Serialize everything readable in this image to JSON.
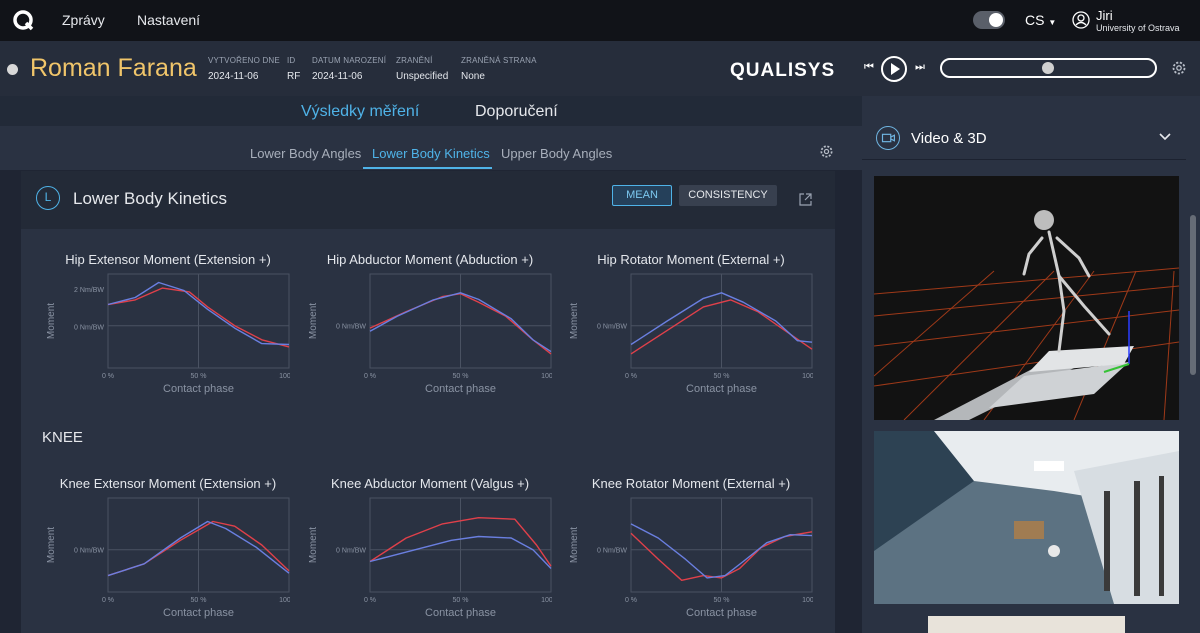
{
  "nav": {
    "messages": "Zprávy",
    "settings": "Nastavení",
    "lang": "CS",
    "user_name": "Jiri",
    "user_org": "University of Ostrava"
  },
  "patient": {
    "name": "Roman Farana",
    "fields": [
      {
        "key": "VYTVOŘENO DNE",
        "value": "2024-11-06"
      },
      {
        "key": "ID",
        "value": "RF"
      },
      {
        "key": "DATUM NAROZENÍ",
        "value": "2024-11-06"
      },
      {
        "key": "ZRANĚNÍ",
        "value": "Unspecified"
      },
      {
        "key": "ZRANĚNÁ STRANA",
        "value": "None"
      }
    ]
  },
  "brand": "QUALISYS",
  "tabs": {
    "results": "Výsledky měření",
    "recommendations": "Doporučení"
  },
  "subtabs": [
    "Lower Body Angles",
    "Lower Body Kinetics",
    "Upper Body Angles"
  ],
  "panel": {
    "badge": "L",
    "title": "Lower Body Kinetics",
    "mean": "MEAN",
    "consistency": "CONSISTENCY"
  },
  "knee_section": "KNEE",
  "axis": {
    "ylabel": "Moment",
    "xlabel": "Contact phase",
    "ticks": [
      "0 %",
      "50 %",
      "100 %"
    ]
  },
  "charts": [
    {
      "title": "Hip Extensor Moment (Extension +)",
      "ylabels": [
        "2 Nm/BW",
        "0 Nm/BW"
      ]
    },
    {
      "title": "Hip Abductor Moment (Abduction +)",
      "ylabels": [
        "0 Nm/BW"
      ]
    },
    {
      "title": "Hip Rotator Moment (External +)",
      "ylabels": [
        "0 Nm/BW"
      ]
    },
    {
      "title": "Knee Extensor Moment (Extension +)",
      "ylabels": [
        "0 Nm/BW"
      ]
    },
    {
      "title": "Knee Abductor Moment (Valgus +)",
      "ylabels": [
        "0 Nm/BW"
      ]
    },
    {
      "title": "Knee Rotator Moment (External +)",
      "ylabels": [
        "0 Nm/BW"
      ]
    }
  ],
  "side": {
    "video_title": "Video & 3D"
  },
  "colors": {
    "accent": "#4fb3e8",
    "name": "#f0c56a",
    "series_red": "#e0404a",
    "series_blue": "#6a7fe0"
  }
}
